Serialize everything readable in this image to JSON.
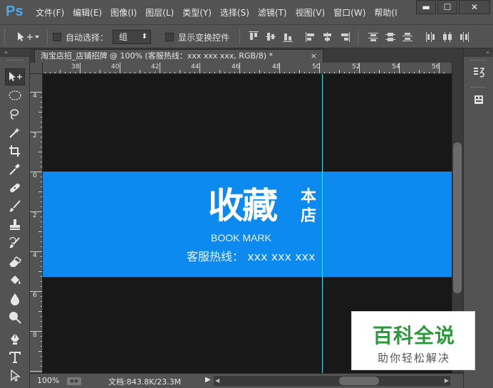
{
  "app": {
    "logo": "Ps"
  },
  "menus": [
    "文件(F)",
    "编辑(E)",
    "图像(I)",
    "图层(L)",
    "类型(Y)",
    "选择(S)",
    "滤镜(T)",
    "视图(V)",
    "窗口(W)",
    "帮助(I"
  ],
  "window_controls": {
    "minimize": "▬",
    "maximize": "☐",
    "close": "✕"
  },
  "options": {
    "auto_select_label": "自动选择：",
    "auto_select_checked": false,
    "group_value": "组",
    "show_transform_label": "显示变换控件",
    "show_transform_checked": false
  },
  "document": {
    "tab_title": "淘宝店招_店铺招牌 @ 100% (客服热线：xxx xxx xxx, RGB/8) *",
    "tab_close": "×"
  },
  "rulers": {
    "top": [
      "38",
      "40",
      "42",
      "44",
      "46",
      "48",
      "50",
      "52",
      "54",
      "56"
    ],
    "left": [
      "4",
      "2",
      "0",
      "2",
      "4",
      "6",
      "8"
    ]
  },
  "banner": {
    "background": "#0d8af0",
    "title": "收藏",
    "title_side": "本店",
    "subtitle": "BOOK MARK",
    "hotline": "客服热线：  xxx xxx xxx"
  },
  "status": {
    "zoom": "100%",
    "doc_info": "文档:843.8K/23.3M",
    "arrow": "▶"
  },
  "right_panel": {
    "history_label": "历",
    "properties_label": "属"
  },
  "watermark": {
    "title": "百科全说",
    "subtitle": "助你轻松解决"
  },
  "icons": {
    "tools": [
      "move-icon",
      "ellipse-marquee-icon",
      "lasso-icon",
      "magic-wand-icon",
      "crop-icon",
      "eyedropper-icon",
      "healing-brush-icon",
      "brush-icon",
      "clone-stamp-icon",
      "history-brush-icon",
      "eraser-icon",
      "paint-bucket-icon",
      "blur-icon",
      "dodge-icon",
      "pen-icon",
      "type-icon",
      "path-selection-icon"
    ]
  }
}
